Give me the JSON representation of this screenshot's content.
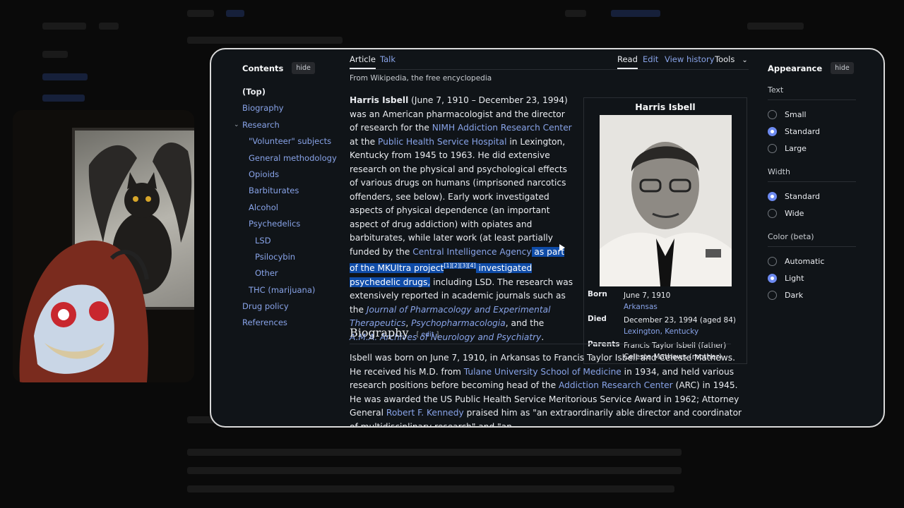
{
  "toc": {
    "title": "Contents",
    "hide": "hide",
    "items": [
      "(Top)",
      "Biography",
      "Research",
      "\"Volunteer\" subjects",
      "General methodology",
      "Opioids",
      "Barbiturates",
      "Alcohol",
      "Psychedelics",
      "LSD",
      "Psilocybin",
      "Other",
      "THC (marijuana)",
      "Drug policy",
      "References"
    ]
  },
  "tabs": {
    "article": "Article",
    "talk": "Talk",
    "read": "Read",
    "edit": "Edit",
    "history": "View history",
    "tools": "Tools"
  },
  "from": "From Wikipedia, the free encyclopedia",
  "lead": {
    "name": "Harris Isbell",
    "t1": " (June 7, 1910 – December 23, 1994) was an American pharmacologist and the director of research for the ",
    "l1": "NIMH Addiction Research Center",
    "t2": " at the ",
    "l2": "Public Health Service Hospital",
    "t3": " in Lexington, Kentucky from 1945 to 1963. He did extensive research on the physical and psychological effects of various drugs on humans (imprisoned narcotics offenders, see below). Early work investigated aspects of physical dependence (an important aspect of drug addiction) with opiates and barbiturates, while later work (at least partially funded by the ",
    "l3": "Central Intelligence Agency",
    "hl1": " as part of the MKUltra project",
    "refs": "[1][2][3][4]",
    "hl2": " investigated psychedelic drugs,",
    "t4": " including LSD. The research was extensively reported in academic journals such as the ",
    "j1": "Journal of Pharmacology and Experimental Therapeutics",
    "t5": ", ",
    "j2": "Psychopharmacologia",
    "t6": ", and the ",
    "j3": "A.M.A. Archives of Neurology and Psychiatry",
    "t7": "."
  },
  "bio_heading": "Biography",
  "bio_edit": "edit",
  "bio": {
    "t1": "Isbell was born on June 7, 1910, in Arkansas to Francis Taylor Isbell and Celeste Mathews. He received his M.D. from ",
    "l1": "Tulane University School of Medicine",
    "t2": " in 1934, and held various research positions before becoming head of the ",
    "l2": "Addiction Research Center",
    "t3": " (ARC) in 1945. He was awarded the US Public Health Service Meritorious Service Award in 1962; Attorney General ",
    "l3": "Robert F. Kennedy",
    "t4": " praised him as \"an extraordinarily able director and coordinator of multidisciplinary research\" and \"an"
  },
  "infobox": {
    "title": "Harris Isbell",
    "born_label": "Born",
    "born_date": "June 7, 1910",
    "born_place": "Arkansas",
    "died_label": "Died",
    "died_date": "December 23, 1994 (aged 84)",
    "died_place": "Lexington, Kentucky",
    "parents_label": "Parents",
    "parent1": "Francis Taylor Isbell (father)",
    "parent2": "Celeste Mathews (mother)"
  },
  "appearance": {
    "title": "Appearance",
    "hide": "hide",
    "text_label": "Text",
    "text_opts": [
      "Small",
      "Standard",
      "Large"
    ],
    "text_selected": "Standard",
    "width_label": "Width",
    "width_opts": [
      "Standard",
      "Wide"
    ],
    "width_selected": "Standard",
    "color_label": "Color (beta)",
    "color_opts": [
      "Automatic",
      "Light",
      "Dark"
    ],
    "color_selected": "Light"
  },
  "colors": {
    "link": "#88a3e8",
    "selection": "#0f4ca8",
    "panel_bg": "#101418"
  }
}
